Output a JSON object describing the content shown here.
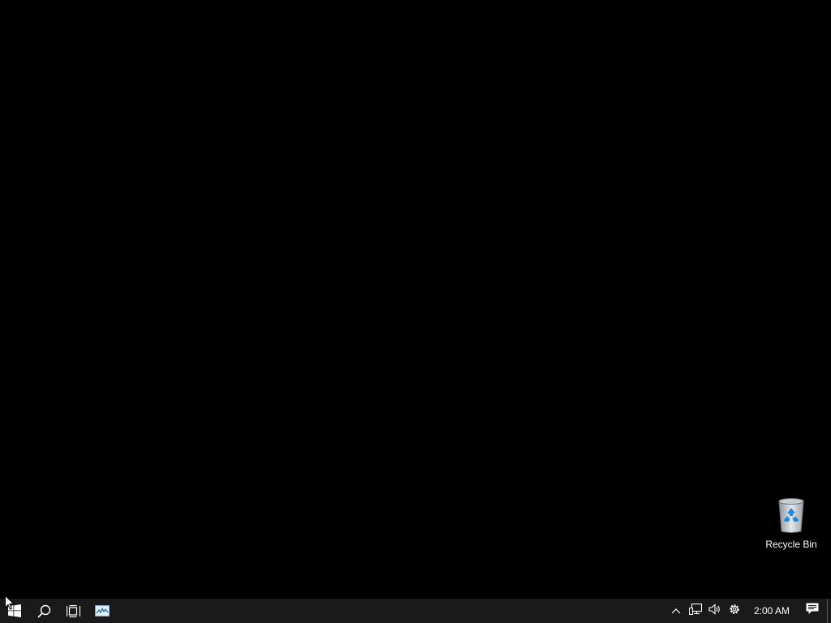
{
  "desktop": {
    "background_color": "#000000",
    "icons": [
      {
        "label": "Recycle Bin",
        "icon": "recycle-bin-icon"
      }
    ]
  },
  "taskbar": {
    "background_color": "#1a1a1a",
    "start_icon": "windows-logo-icon",
    "search_icon": "search-icon",
    "task_view_icon": "task-view-icon",
    "pinned_apps": [
      {
        "icon": "performance-monitor-icon"
      }
    ],
    "tray": {
      "icons": [
        "chevron-up-icon",
        "network-icon",
        "volume-icon",
        "settings-gear-icon"
      ],
      "clock": "2:00 AM",
      "notification_icon": "action-center-icon"
    }
  }
}
